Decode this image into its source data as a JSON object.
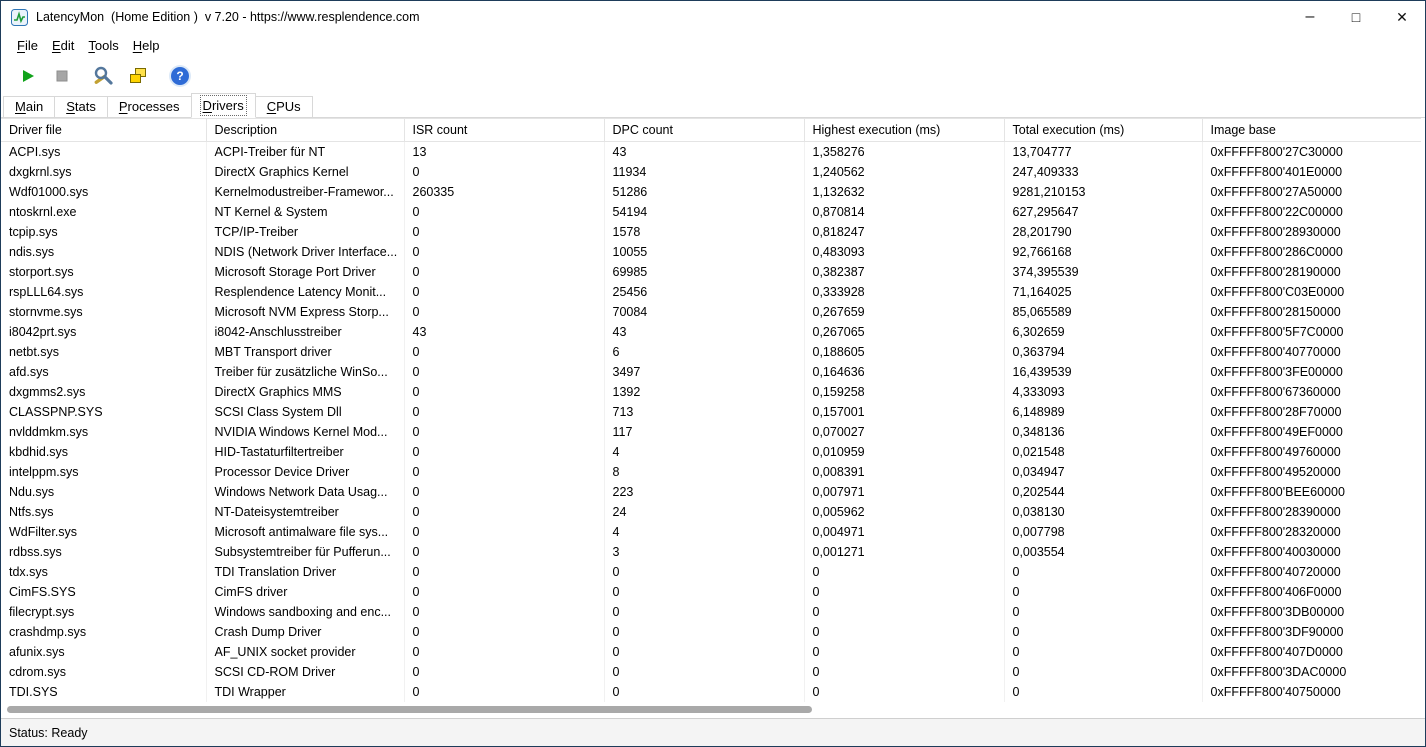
{
  "window": {
    "title": "LatencyMon  (Home Edition )  v 7.20 - https://www.resplendence.com",
    "controls": {
      "minimize": "–",
      "maximize": "□",
      "close": "✕"
    }
  },
  "menu": {
    "items": [
      "File",
      "Edit",
      "Tools",
      "Help"
    ]
  },
  "toolbar": {
    "help_glyph": "?"
  },
  "tabs": {
    "items": [
      "Main",
      "Stats",
      "Processes",
      "Drivers",
      "CPUs"
    ],
    "active": "Drivers"
  },
  "table": {
    "columns": [
      "Driver file",
      "Description",
      "ISR count",
      "DPC count",
      "Highest execution (ms)",
      "Total execution (ms)",
      "Image base"
    ],
    "rows": [
      [
        "ACPI.sys",
        "ACPI-Treiber für NT",
        "13",
        "43",
        "1,358276",
        "13,704777",
        "0xFFFFF800'27C30000"
      ],
      [
        "dxgkrnl.sys",
        "DirectX Graphics Kernel",
        "0",
        "11934",
        "1,240562",
        "247,409333",
        "0xFFFFF800'401E0000"
      ],
      [
        "Wdf01000.sys",
        "Kernelmodustreiber-Framewor...",
        "260335",
        "51286",
        "1,132632",
        "9281,210153",
        "0xFFFFF800'27A50000"
      ],
      [
        "ntoskrnl.exe",
        "NT Kernel & System",
        "0",
        "54194",
        "0,870814",
        "627,295647",
        "0xFFFFF800'22C00000"
      ],
      [
        "tcpip.sys",
        "TCP/IP-Treiber",
        "0",
        "1578",
        "0,818247",
        "28,201790",
        "0xFFFFF800'28930000"
      ],
      [
        "ndis.sys",
        "NDIS (Network Driver Interface...",
        "0",
        "10055",
        "0,483093",
        "92,766168",
        "0xFFFFF800'286C0000"
      ],
      [
        "storport.sys",
        "Microsoft Storage Port Driver",
        "0",
        "69985",
        "0,382387",
        "374,395539",
        "0xFFFFF800'28190000"
      ],
      [
        "rspLLL64.sys",
        "Resplendence Latency Monit...",
        "0",
        "25456",
        "0,333928",
        "71,164025",
        "0xFFFFF800'C03E0000"
      ],
      [
        "stornvme.sys",
        "Microsoft NVM Express Storp...",
        "0",
        "70084",
        "0,267659",
        "85,065589",
        "0xFFFFF800'28150000"
      ],
      [
        "i8042prt.sys",
        "i8042-Anschlusstreiber",
        "43",
        "43",
        "0,267065",
        "6,302659",
        "0xFFFFF800'5F7C0000"
      ],
      [
        "netbt.sys",
        "MBT Transport driver",
        "0",
        "6",
        "0,188605",
        "0,363794",
        "0xFFFFF800'40770000"
      ],
      [
        "afd.sys",
        "Treiber für zusätzliche WinSo...",
        "0",
        "3497",
        "0,164636",
        "16,439539",
        "0xFFFFF800'3FE00000"
      ],
      [
        "dxgmms2.sys",
        "DirectX Graphics MMS",
        "0",
        "1392",
        "0,159258",
        "4,333093",
        "0xFFFFF800'67360000"
      ],
      [
        "CLASSPNP.SYS",
        "SCSI Class System Dll",
        "0",
        "713",
        "0,157001",
        "6,148989",
        "0xFFFFF800'28F70000"
      ],
      [
        "nvlddmkm.sys",
        "NVIDIA Windows Kernel Mod...",
        "0",
        "117",
        "0,070027",
        "0,348136",
        "0xFFFFF800'49EF0000"
      ],
      [
        "kbdhid.sys",
        "HID-Tastaturfiltertreiber",
        "0",
        "4",
        "0,010959",
        "0,021548",
        "0xFFFFF800'49760000"
      ],
      [
        "intelppm.sys",
        "Processor Device Driver",
        "0",
        "8",
        "0,008391",
        "0,034947",
        "0xFFFFF800'49520000"
      ],
      [
        "Ndu.sys",
        "Windows Network Data Usag...",
        "0",
        "223",
        "0,007971",
        "0,202544",
        "0xFFFFF800'BEE60000"
      ],
      [
        "Ntfs.sys",
        "NT-Dateisystemtreiber",
        "0",
        "24",
        "0,005962",
        "0,038130",
        "0xFFFFF800'28390000"
      ],
      [
        "WdFilter.sys",
        "Microsoft antimalware file sys...",
        "0",
        "4",
        "0,004971",
        "0,007798",
        "0xFFFFF800'28320000"
      ],
      [
        "rdbss.sys",
        "Subsystemtreiber für Pufferun...",
        "0",
        "3",
        "0,001271",
        "0,003554",
        "0xFFFFF800'40030000"
      ],
      [
        "tdx.sys",
        "TDI Translation Driver",
        "0",
        "0",
        "0",
        "0",
        "0xFFFFF800'40720000"
      ],
      [
        "CimFS.SYS",
        "CimFS driver",
        "0",
        "0",
        "0",
        "0",
        "0xFFFFF800'406F0000"
      ],
      [
        "filecrypt.sys",
        "Windows sandboxing and enc...",
        "0",
        "0",
        "0",
        "0",
        "0xFFFFF800'3DB00000"
      ],
      [
        "crashdmp.sys",
        "Crash Dump Driver",
        "0",
        "0",
        "0",
        "0",
        "0xFFFFF800'3DF90000"
      ],
      [
        "afunix.sys",
        "AF_UNIX socket provider",
        "0",
        "0",
        "0",
        "0",
        "0xFFFFF800'407D0000"
      ],
      [
        "cdrom.sys",
        "SCSI CD-ROM Driver",
        "0",
        "0",
        "0",
        "0",
        "0xFFFFF800'3DAC0000"
      ],
      [
        "TDI.SYS",
        "TDI Wrapper",
        "0",
        "0",
        "0",
        "0",
        "0xFFFFF800'40750000"
      ]
    ]
  },
  "status": {
    "text": "Status: Ready"
  }
}
